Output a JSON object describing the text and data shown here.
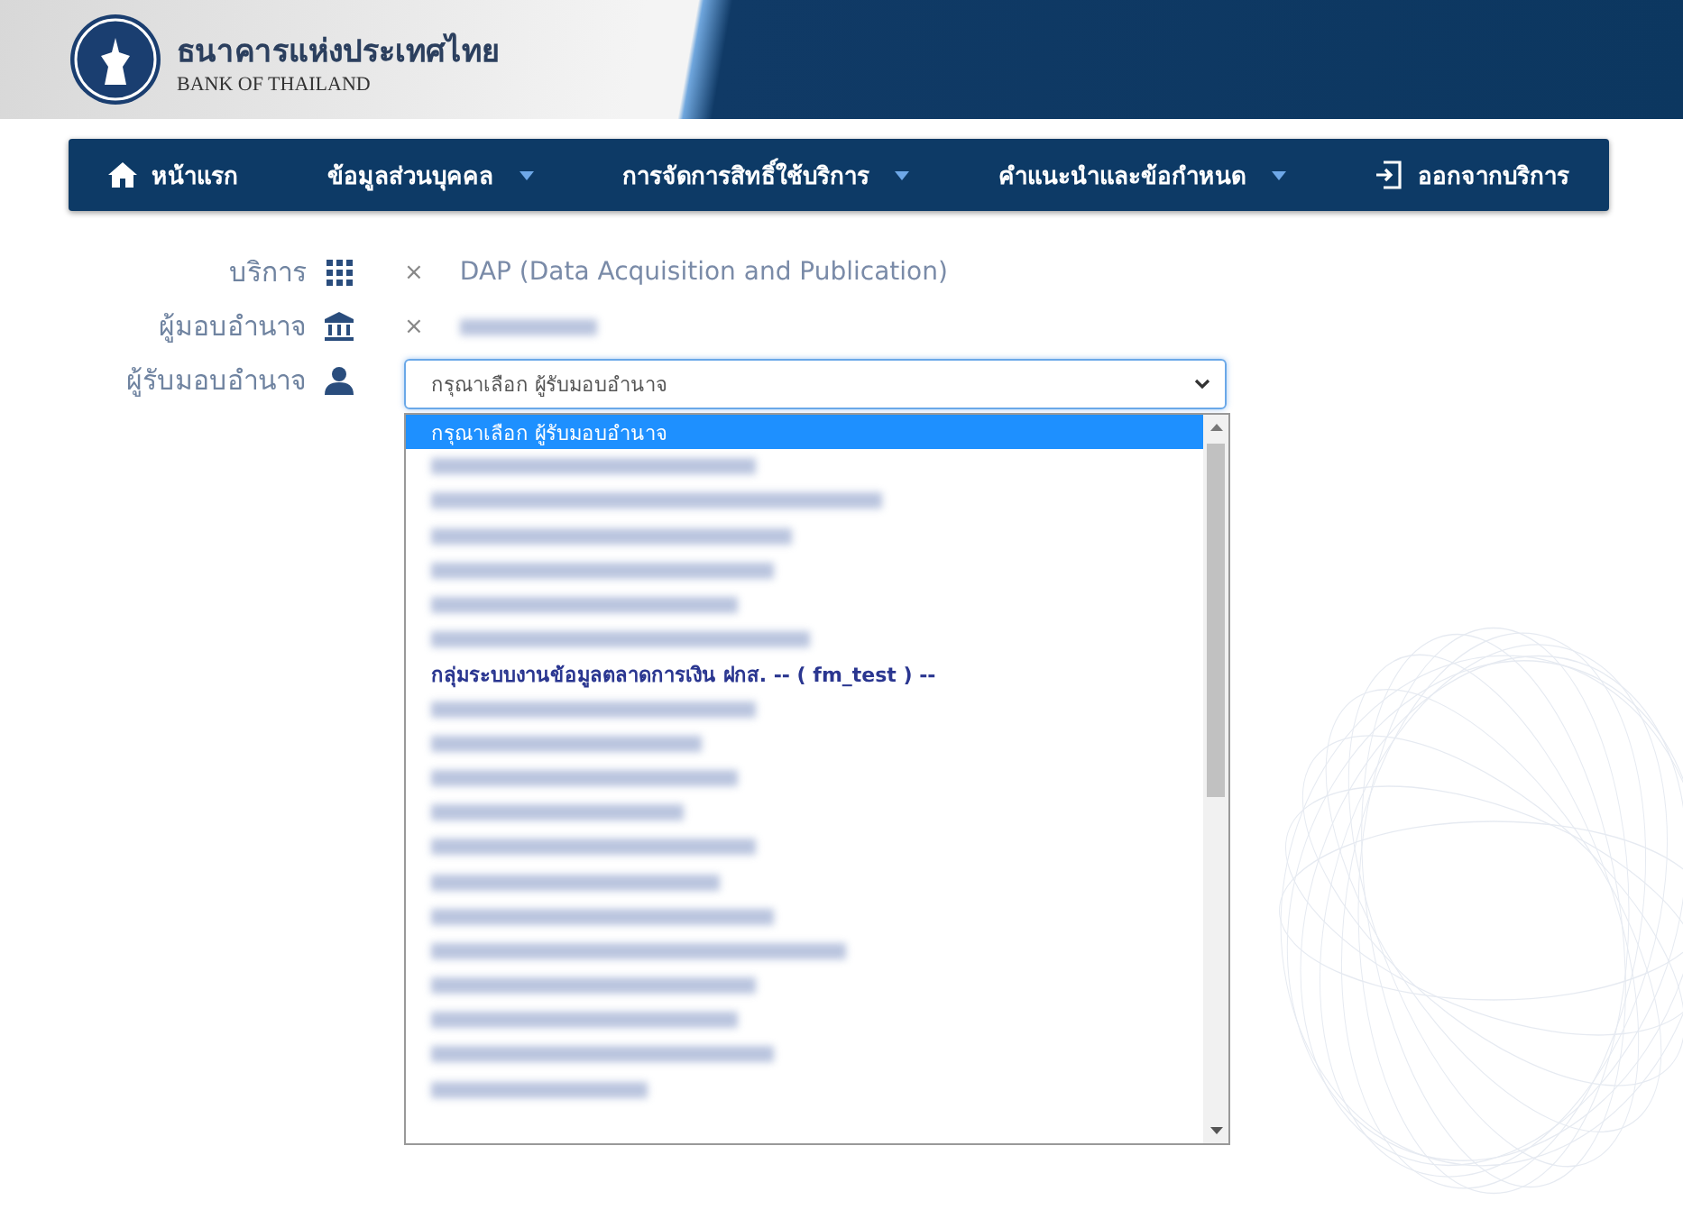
{
  "header": {
    "title_th": "ธนาคารแห่งประเทศไทย",
    "title_en": "BANK OF THAILAND"
  },
  "nav": [
    {
      "label": "หน้าแรก",
      "kind": "home",
      "dropdown": false
    },
    {
      "label": "ข้อมูลส่วนบุคคล",
      "kind": "menu",
      "dropdown": true
    },
    {
      "label": "การจัดการสิทธิ์ใช้บริการ",
      "kind": "menu",
      "dropdown": true
    },
    {
      "label": "คำแนะนำและข้อกำหนด",
      "kind": "menu",
      "dropdown": true
    },
    {
      "label": "ออกจากบริการ",
      "kind": "logout",
      "dropdown": false
    }
  ],
  "form": [
    {
      "label": "บริการ",
      "kind": "value",
      "remove": "×",
      "value": "DAP (Data Acquisition and Publication)"
    },
    {
      "label": "ผู้มอบอำนาจ",
      "kind": "redacted",
      "remove": "×"
    },
    {
      "label": "ผู้รับมอบอำนาจ",
      "kind": "select",
      "value": "กรุณาเลือก ผู้รับมอบอำนาจ"
    }
  ],
  "dropdown_options": [
    {
      "kind": "text",
      "label": "กรุณาเลือก ผู้รับมอบอำนาจ",
      "selected": true
    },
    {
      "kind": "redacted",
      "selected": false
    },
    {
      "kind": "redacted",
      "selected": false
    },
    {
      "kind": "redacted",
      "selected": false
    },
    {
      "kind": "redacted",
      "selected": false
    },
    {
      "kind": "redacted",
      "selected": false
    },
    {
      "kind": "redacted",
      "selected": false
    },
    {
      "kind": "group",
      "label": "กลุ่มระบบงานข้อมูลตลาดการเงิน ฝกส. -- ( fm_test ) --",
      "selected": false
    },
    {
      "kind": "redacted",
      "selected": false
    },
    {
      "kind": "redacted",
      "selected": false
    },
    {
      "kind": "redacted",
      "selected": false
    },
    {
      "kind": "redacted",
      "selected": false
    },
    {
      "kind": "redacted",
      "selected": false
    },
    {
      "kind": "redacted",
      "selected": false
    },
    {
      "kind": "redacted",
      "selected": false
    },
    {
      "kind": "redacted",
      "selected": false
    },
    {
      "kind": "redacted",
      "selected": false
    },
    {
      "kind": "redacted",
      "selected": false
    },
    {
      "kind": "redacted",
      "selected": false
    },
    {
      "kind": "redacted",
      "selected": false
    }
  ]
}
